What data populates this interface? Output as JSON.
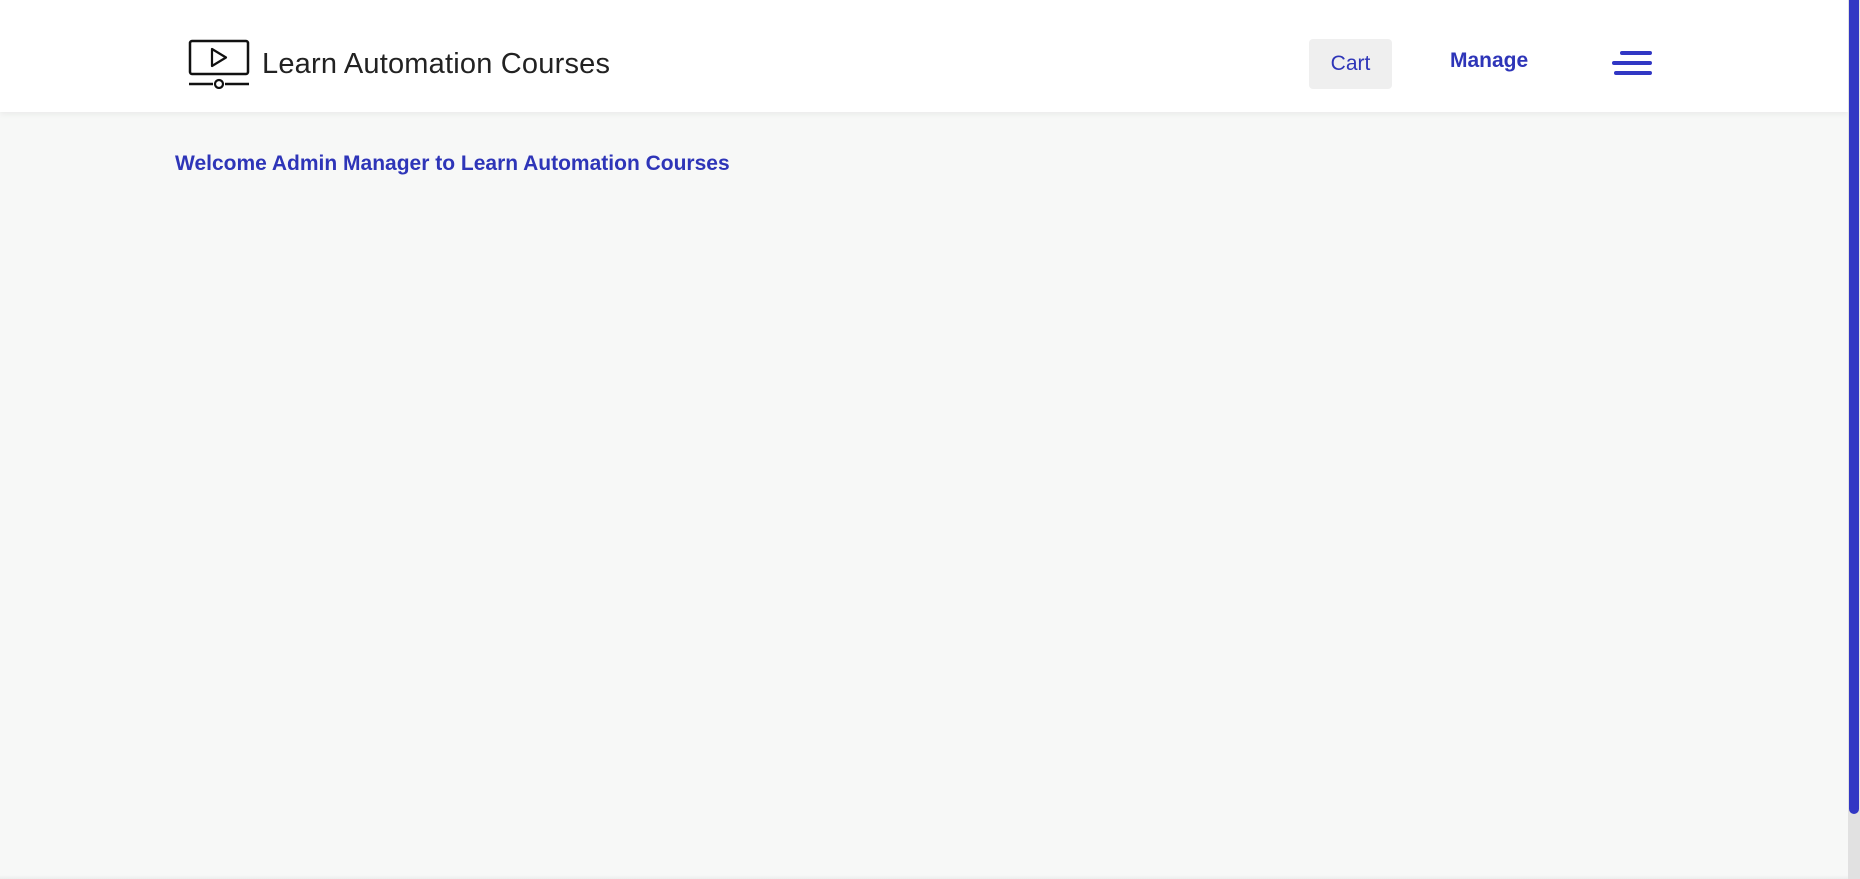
{
  "header": {
    "brand_title": "Learn Automation Courses",
    "brand_icon": "video-lesson-icon",
    "cart_label": "Cart",
    "manage_label": "Manage",
    "menu_icon": "hamburger-menu-icon"
  },
  "main": {
    "welcome_text": "Welcome Admin Manager to Learn Automation Courses"
  },
  "colors": {
    "accent": "#3137c4",
    "link_text": "#2e35b8",
    "page_background": "#f7f8f7",
    "header_background": "#ffffff",
    "cart_background": "#efefef"
  }
}
